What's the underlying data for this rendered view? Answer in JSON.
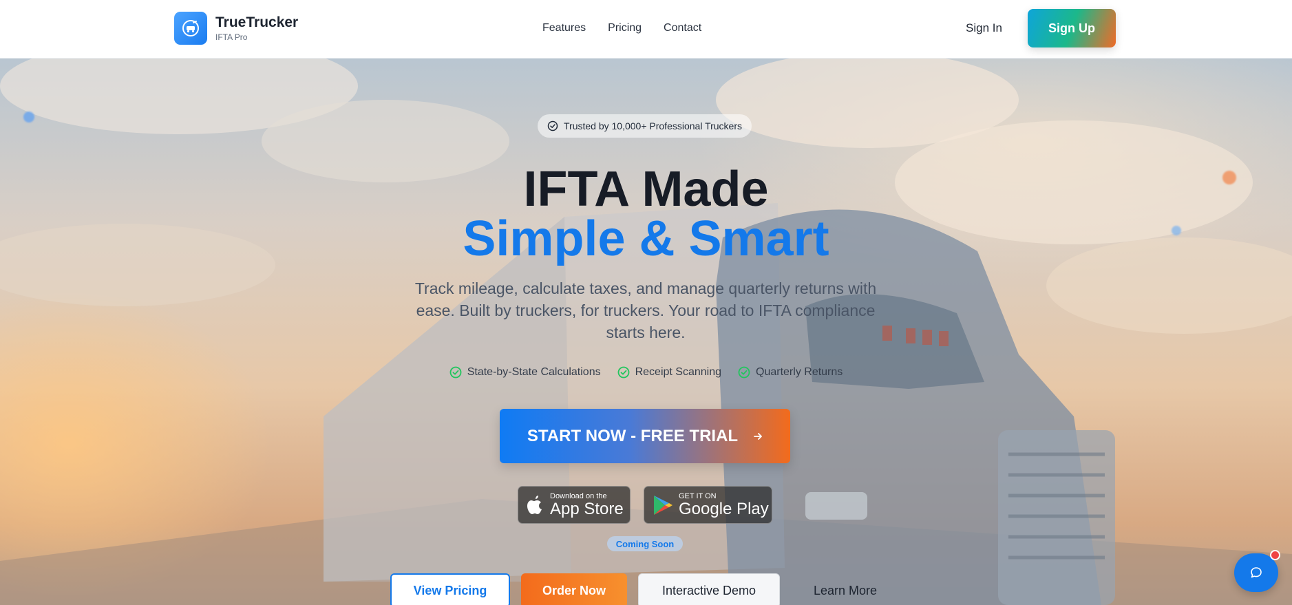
{
  "header": {
    "brand_name": "TrueTrucker",
    "brand_sub": "IFTA Pro",
    "nav": [
      "Features",
      "Pricing",
      "Contact"
    ],
    "signin_label": "Sign In",
    "signup_label": "Sign Up"
  },
  "hero": {
    "badge": "Trusted by 10,000+ Professional Truckers",
    "title_line1": "IFTA Made",
    "title_line2": "Simple & Smart",
    "description": "Track mileage, calculate taxes, and manage quarterly returns with ease. Built by truckers, for truckers. Your road to IFTA compliance starts here.",
    "features": [
      "State-by-State Calculations",
      "Receipt Scanning",
      "Quarterly Returns"
    ],
    "cta_label": "START NOW - FREE TRIAL",
    "app_store": {
      "small": "Download on the",
      "big": "App Store"
    },
    "google_play": {
      "small": "GET IT ON",
      "big": "Google Play"
    },
    "coming_soon": "Coming Soon",
    "buttons": {
      "pricing": "View Pricing",
      "order": "Order Now",
      "demo": "Interactive Demo",
      "learn": "Learn More"
    }
  },
  "colors": {
    "accent_blue": "#1479ea",
    "accent_orange": "#f36b1c",
    "check_green": "#22c55e",
    "notification_red": "#ef4444"
  },
  "icons": {
    "logo": "truck-icon",
    "badge": "check-circle-icon",
    "feature": "check-circle-icon",
    "cta": "arrow-right-icon",
    "app_store": "apple-icon",
    "google_play": "play-store-icon",
    "chat": "chat-icon"
  }
}
